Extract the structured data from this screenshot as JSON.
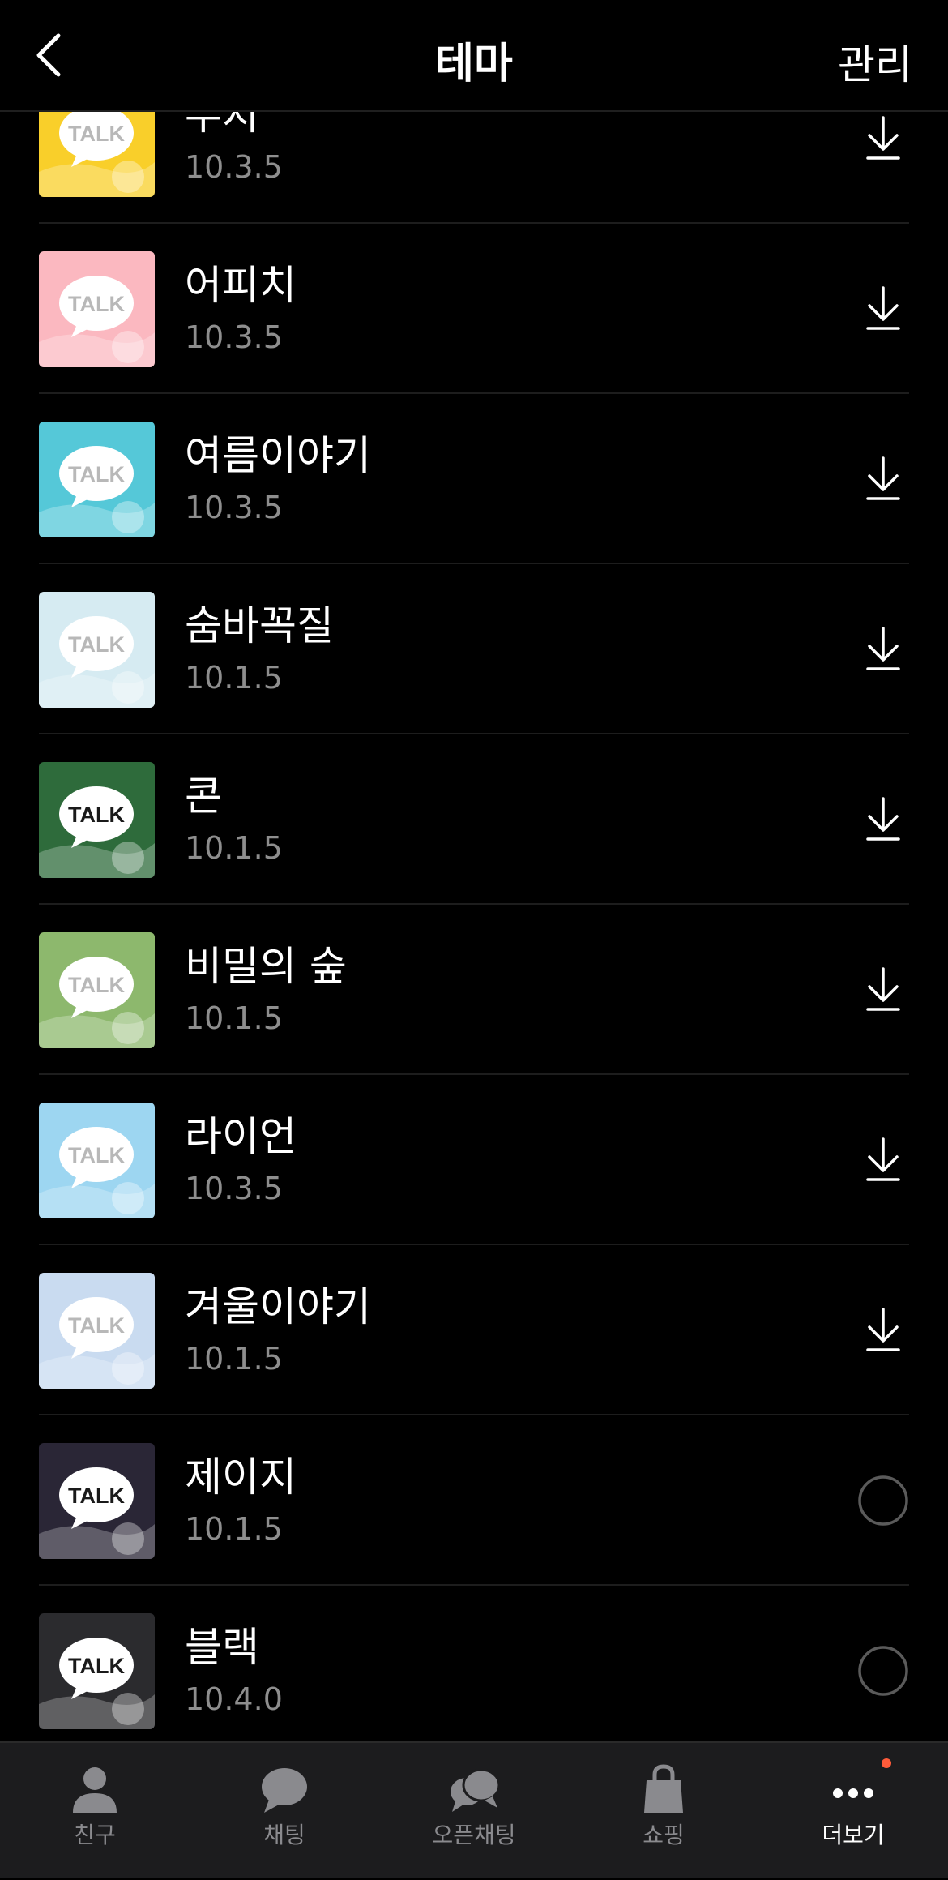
{
  "header": {
    "title": "테마",
    "manage_label": "관리"
  },
  "themes": [
    {
      "name": "무지",
      "version": "10.3.5",
      "action": "download",
      "thumb_bg": "#f9cf2a"
    },
    {
      "name": "어피치",
      "version": "10.3.5",
      "action": "download",
      "thumb_bg": "#fbb8c0"
    },
    {
      "name": "여름이야기",
      "version": "10.3.5",
      "action": "download",
      "thumb_bg": "#55c8d8"
    },
    {
      "name": "숨바꼭질",
      "version": "10.1.5",
      "action": "download",
      "thumb_bg": "#d6ebf2"
    },
    {
      "name": "콘",
      "version": "10.1.5",
      "action": "download",
      "thumb_bg": "#2e6b3b"
    },
    {
      "name": "비밀의 숲",
      "version": "10.1.5",
      "action": "download",
      "thumb_bg": "#8db86d"
    },
    {
      "name": "라이언",
      "version": "10.3.5",
      "action": "download",
      "thumb_bg": "#9dd6f1"
    },
    {
      "name": "겨울이야기",
      "version": "10.1.5",
      "action": "download",
      "thumb_bg": "#c9dbf0"
    },
    {
      "name": "제이지",
      "version": "10.1.5",
      "action": "select",
      "thumb_bg": "#2a2636"
    },
    {
      "name": "블랙",
      "version": "10.4.0",
      "action": "select",
      "thumb_bg": "#2b2b2e"
    }
  ],
  "tabs": [
    {
      "label": "친구",
      "icon": "person-icon"
    },
    {
      "label": "채팅",
      "icon": "chat-bubble-icon"
    },
    {
      "label": "오픈채팅",
      "icon": "open-chat-icon"
    },
    {
      "label": "쇼핑",
      "icon": "shopping-bag-icon"
    },
    {
      "label": "더보기",
      "icon": "more-dots-icon",
      "active": true,
      "has_badge": true
    }
  ],
  "colors": {
    "badge": "#ff5b3a",
    "secondary_text": "#8e8e8e",
    "tabbar_bg": "#1c1c1e"
  }
}
